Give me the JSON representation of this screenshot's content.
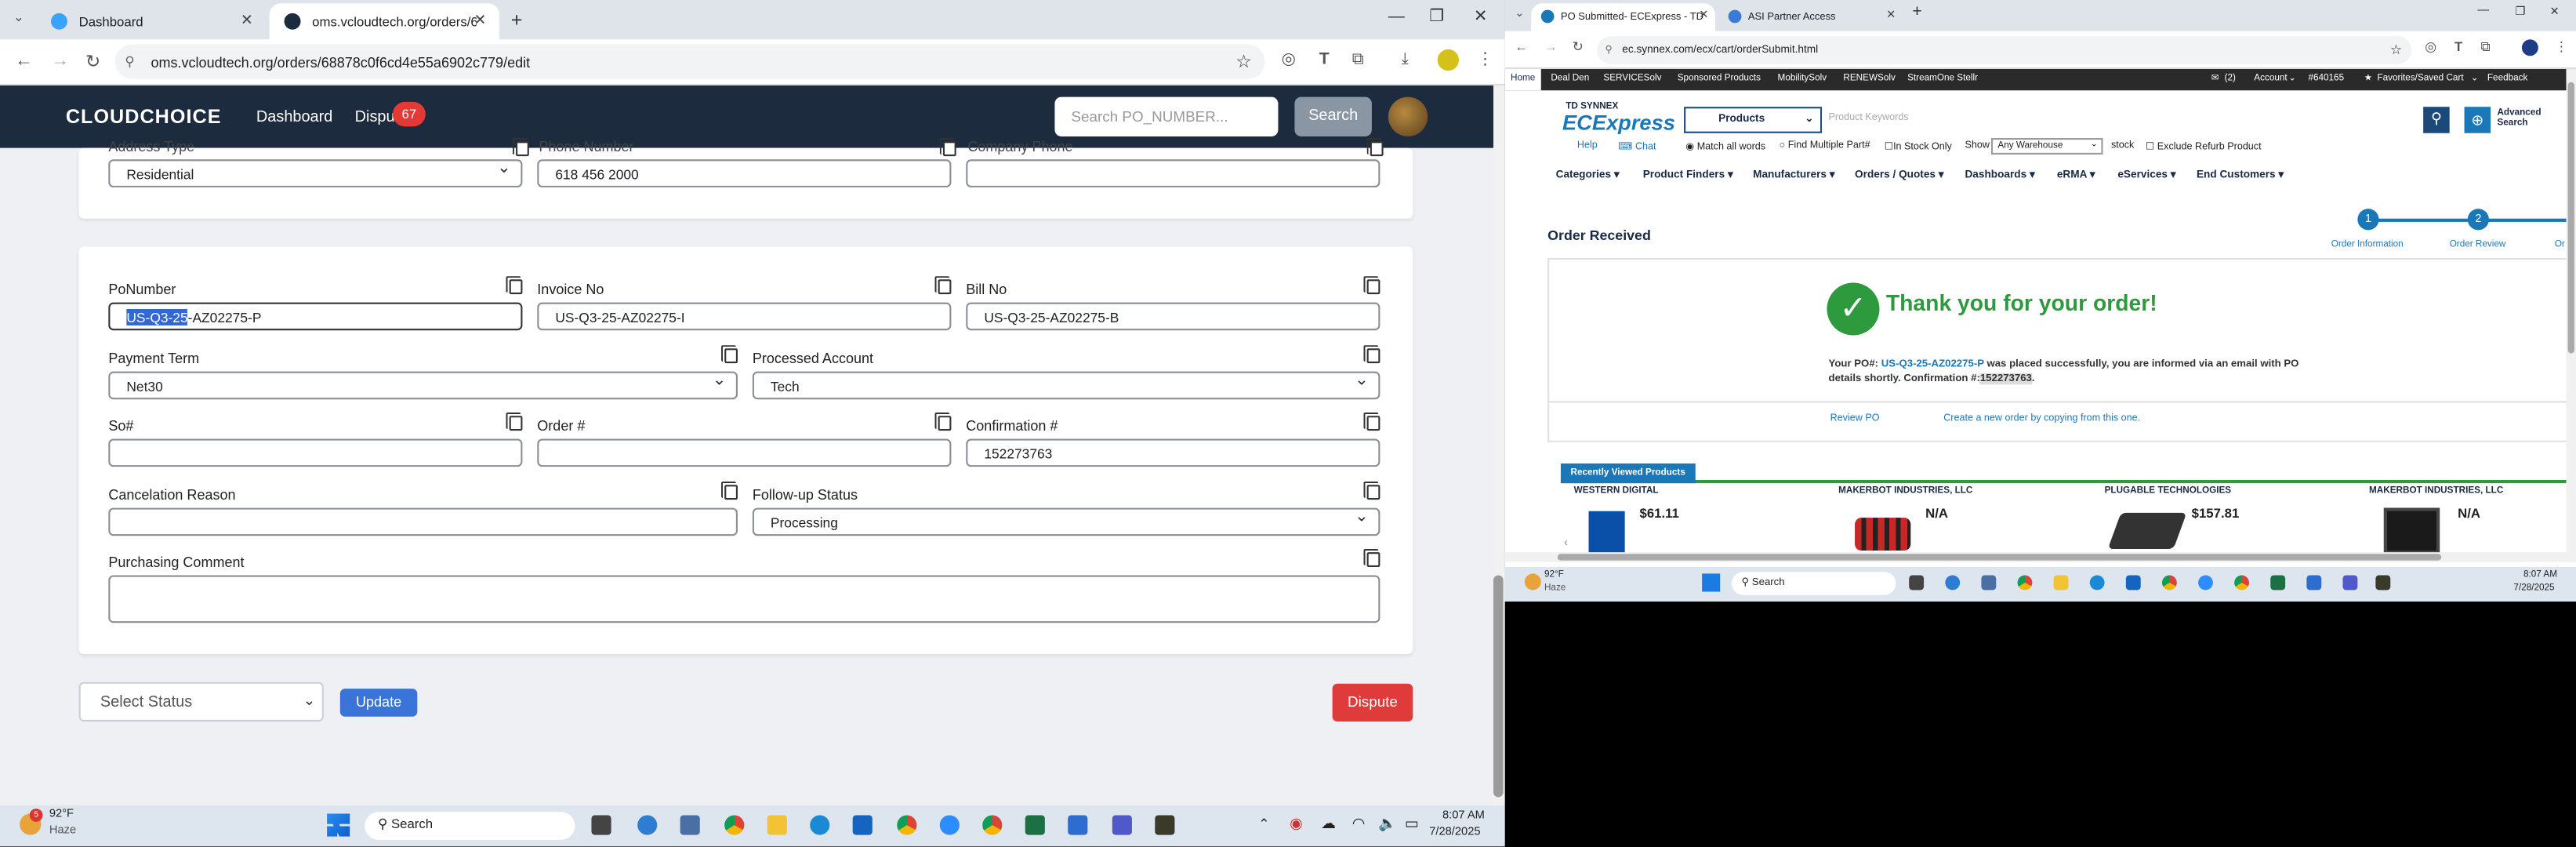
{
  "left_browser": {
    "tabs": [
      {
        "label": "Dashboard",
        "active": false
      },
      {
        "label": "oms.vcloudtech.org/orders/68",
        "active": true
      }
    ],
    "url": "oms.vcloudtech.org/orders/68878c0f6cd4e55a6902c779/edit"
  },
  "app": {
    "logo": "CLOUDCHOICE",
    "nav": {
      "dashboard": "Dashboard",
      "disputes": "Dispu",
      "disputes_badge": "67"
    },
    "search_placeholder": "Search PO_NUMBER...",
    "search_button": "Search",
    "top_card": {
      "address_type_label": "Address Type",
      "address_type_value": "Residential",
      "phone_label": "Phone Number",
      "phone_value": "618 456 2000",
      "company_phone_label": "Company Phone",
      "company_phone_value": ""
    },
    "form": {
      "po_label": "PoNumber",
      "po_selected": "US-Q3-25",
      "po_rest": "-AZ02275-P",
      "invoice_label": "Invoice No",
      "invoice_value": "US-Q3-25-AZ02275-I",
      "bill_label": "Bill No",
      "bill_value": "US-Q3-25-AZ02275-B",
      "payment_term_label": "Payment Term",
      "payment_term_value": "Net30",
      "processed_account_label": "Processed Account",
      "processed_account_value": "Tech",
      "so_label": "So#",
      "so_value": "",
      "order_label": "Order #",
      "order_value": "",
      "confirmation_label": "Confirmation #",
      "confirmation_value": "152273763",
      "cancel_reason_label": "Cancelation Reason",
      "cancel_reason_value": "",
      "followup_label": "Follow-up Status",
      "followup_value": "Processing",
      "comment_label": "Purchasing Comment",
      "comment_value": ""
    },
    "select_status": "Select Status",
    "update_button": "Update",
    "dispute_button": "Dispute"
  },
  "left_taskbar": {
    "weather_temp": "92°F",
    "weather_desc": "Haze",
    "weather_badge": "5",
    "search": "Search",
    "time": "8:07 AM",
    "date": "7/28/2025"
  },
  "right_browser": {
    "tabs": [
      {
        "label": "PO Submitted- ECExpress - TD",
        "active": true
      },
      {
        "label": "ASI Partner Access",
        "active": false
      }
    ],
    "url": "ec.synnex.com/ecx/cart/orderSubmit.html"
  },
  "ecx": {
    "sys_links": [
      "Home",
      "Deal Den",
      "SERVICESolv",
      "Sponsored Products",
      "MobilitySolv",
      "RENEWSolv",
      "StreamOne Stellr"
    ],
    "sys_right": [
      "(2)",
      "Account",
      "#640165",
      "Favorites/Saved Cart",
      "Feedback"
    ],
    "brand_top": "TD SYNNEX",
    "brand_bottom": "ECExpress",
    "products_dropdown": "Products",
    "keyword_placeholder": "Product Keywords",
    "advanced_search": "Advanced Search",
    "help": "Help",
    "chat": "Chat",
    "match_all": "Match all words",
    "find_multiple": "Find Multiple Part#",
    "in_stock": "In Stock Only",
    "show_label": "Show",
    "warehouse": "Any Warehouse",
    "stock": "stock",
    "exclude_refurb": "Exclude Refurb Product",
    "menu": [
      "Categories",
      "Product Finders",
      "Manufacturers",
      "Orders / Quotes",
      "Dashboards",
      "eRMA",
      "eServices",
      "End Customers"
    ],
    "order_received": "Order Received",
    "steps": [
      {
        "num": "1",
        "label": "Order Information"
      },
      {
        "num": "2",
        "label": "Order Review"
      },
      {
        "num": "",
        "label": "Or"
      }
    ],
    "thank_you": "Thank you for your order!",
    "po_prefix": "Your PO#:",
    "po_number": "US-Q3-25-AZ02275-P",
    "po_line1_rest": "was placed successfully, you are informed via an email with PO",
    "po_line2": "details shortly. Confirmation #:",
    "confirmation": "152273763",
    "review_po": "Review PO",
    "create_new": "Create a new order by copying from this one.",
    "recently_viewed": "Recently Viewed Products",
    "products": [
      {
        "maker": "WESTERN DIGITAL",
        "price": "$61.11"
      },
      {
        "maker": "MAKERBOT INDUSTRIES, LLC",
        "price": "N/A"
      },
      {
        "maker": "PLUGABLE TECHNOLOGIES",
        "price": "$157.81"
      },
      {
        "maker": "MAKERBOT INDUSTRIES, LLC",
        "price": "N/A"
      }
    ]
  },
  "right_taskbar": {
    "weather_temp": "92°F",
    "weather_desc": "Haze",
    "search": "Search",
    "time": "8:07 AM",
    "date": "7/28/2025"
  }
}
